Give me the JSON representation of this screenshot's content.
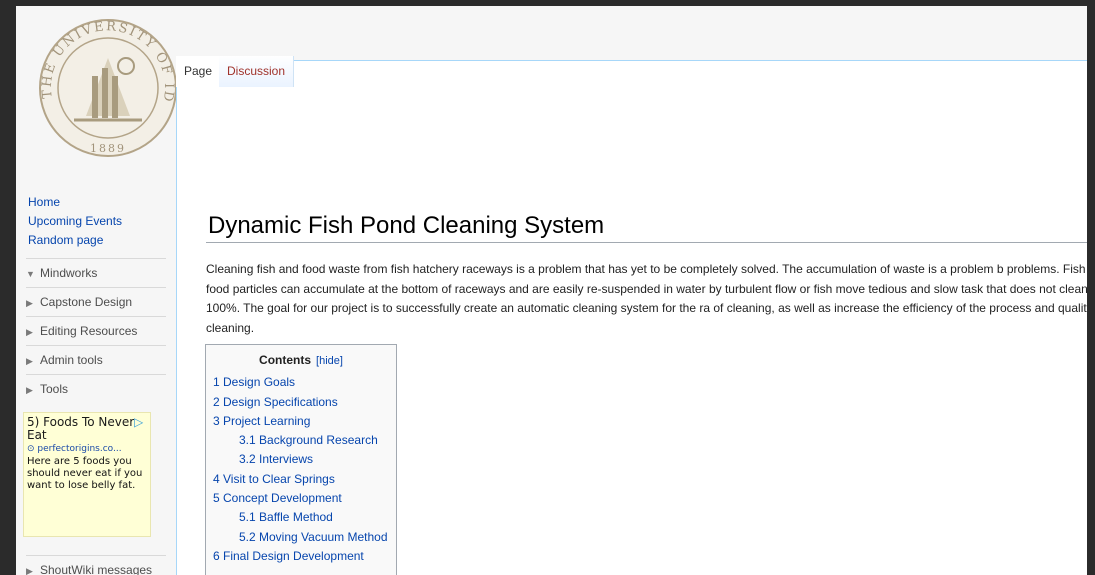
{
  "tabs": {
    "page": "Page",
    "discussion": "Discussion"
  },
  "sidebar": {
    "links": [
      "Home",
      "Upcoming Events",
      "Random page"
    ],
    "portals": [
      {
        "label": "Mindworks",
        "expanded": true
      },
      {
        "label": "Capstone Design",
        "expanded": false
      },
      {
        "label": "Editing Resources",
        "expanded": false
      },
      {
        "label": "Admin tools",
        "expanded": false
      },
      {
        "label": "Tools",
        "expanded": false
      },
      {
        "label": "ShoutWiki messages",
        "expanded": false
      }
    ],
    "ad": {
      "title": "5) Foods To Never Eat",
      "source": "perfectorigins.co...",
      "body": "Here are 5 foods you should never eat if you want to lose belly fat."
    }
  },
  "logo": {
    "top_text": "THE UNIVERSITY OF IDAHO",
    "year": "1889"
  },
  "page": {
    "title": "Dynamic Fish Pond Cleaning System",
    "intro": "Cleaning fish and food waste from fish hatchery raceways is a problem that has yet to be completely solved. The accumulation of waste is a problem b problems. Fish waste and food particles can accumulate at the bottom of raceways and are easily re-suspended in water by turbulent flow or fish move tedious and slow task that does not clean the raceway 100%. The goal for our project is to successfully create an automatic cleaning system for the ra of cleaning, as well as increase the efficiency of the process and quality of the cleaning."
  },
  "toc": {
    "heading": "Contents",
    "hide": "[hide]",
    "items": [
      {
        "label": "1 Design Goals",
        "sub": false
      },
      {
        "label": "2 Design Specifications",
        "sub": false
      },
      {
        "label": "3 Project Learning",
        "sub": false
      },
      {
        "label": "3.1 Background Research",
        "sub": true
      },
      {
        "label": "3.2 Interviews",
        "sub": true
      },
      {
        "label": "4 Visit to Clear Springs",
        "sub": false
      },
      {
        "label": "5 Concept Development",
        "sub": false
      },
      {
        "label": "5.1 Baffle Method",
        "sub": true
      },
      {
        "label": "5.2 Moving Vacuum Method",
        "sub": true
      },
      {
        "label": "6 Final Design Development",
        "sub": false
      }
    ]
  },
  "colors": {
    "link": "#0645ad",
    "tab_discussion": "#a0322b",
    "seal": "#b3a488"
  }
}
